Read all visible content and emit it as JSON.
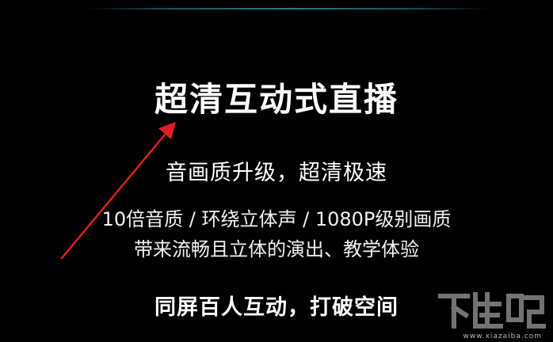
{
  "slide": {
    "title": "超清互动式直播",
    "subtitle": "音画质升级，超清极速",
    "feature_line_1": "10倍音质 / 环绕立体声 / 1080P级别画质",
    "feature_line_2": "带来流畅且立体的演出、教学体验",
    "interaction_line": "同屏百人互动，打破空间"
  },
  "watermark": {
    "logo_text": "下载吧",
    "url": "www.xiazaiba.com"
  },
  "colors": {
    "background": "#000000",
    "text": "#ffffff",
    "arrow": "#e02020",
    "top_glow": "#2f8a99"
  },
  "icons": {
    "annotation": "red-arrow-icon"
  }
}
